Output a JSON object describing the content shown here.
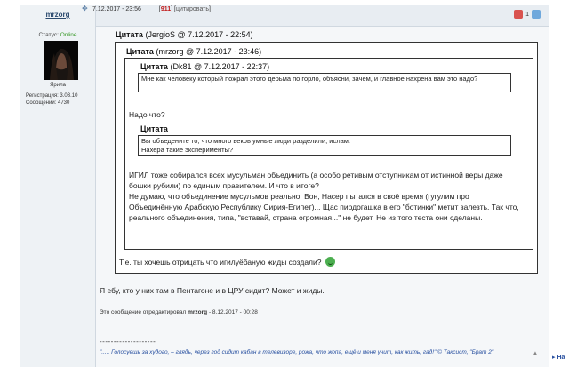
{
  "author": {
    "name": "mrzorg",
    "status_label": "Статус:",
    "status_value": "Online",
    "avatar_caption": "Ярила",
    "registration": "Регистрация: 3.03.10",
    "messages": "Сообщений: 4730"
  },
  "post": {
    "datetime": "7.12.2017 - 23:56",
    "number": "911",
    "quote_action": "цитировать",
    "rating_value": "1"
  },
  "quote_outer": {
    "label": "Цитата",
    "meta": "(JergioS @ 7.12.2017 - 22:54)"
  },
  "quote_mid": {
    "label": "Цитата",
    "meta": "(mrzorg @ 7.12.2017 - 23:46)"
  },
  "quote_inner": {
    "label": "Цитата",
    "meta": "(Dk81 @ 7.12.2017 - 22:37)",
    "text": "Мне как человеку который пожрал этого дерьма по горло, объясни, зачем, и главное нахрена вам это надо?"
  },
  "mid_reply": "Надо что?",
  "quote_inner2": {
    "label": "Цитата",
    "line1": "Вы объедените то, что много веков умные люди разделили, ислам.",
    "line2": "Нахера такие эксперименты?"
  },
  "mid_body": {
    "p1": "ИГИЛ тоже собирался всех мусульман объединить (а особо ретивым отступникам от истинной веры даже бошки рубили) по единым правителем. И что в итоге?",
    "p2": "Не думаю, что объединение мусульмов реально. Вон, Насер пытался в своё время (гугулим про Объединённую Арабскую Республику Сирия-Египет)... Щас пирдогашка в его \"ботинки\" метит залезть. Так что, реального объединения, типа, \"вставай, страна огромная...\" не будет. Не из того теста они сделаны."
  },
  "outer_reply": "Т.е. ты хочешь отрицать что игилуёбаную жиды создали?",
  "main_text": "Я ебу, кто у них там в Пентагоне и в ЦРУ сидит? Может и жиды.",
  "edited": {
    "prefix": "Это сообщение отредактировал",
    "user": "mrzorg",
    "suffix": "- 8.12.2017 - 00:28"
  },
  "signature": {
    "divider": "--------------------",
    "text": "\"..... Голосуешь за худого, – глядь, через год сидит кабан в телевизоре, рожа, что жопа, ещё и меня учит, как жить, гад!\" © Таксист, \"Брат 2\""
  },
  "nav": {
    "label": "На"
  }
}
